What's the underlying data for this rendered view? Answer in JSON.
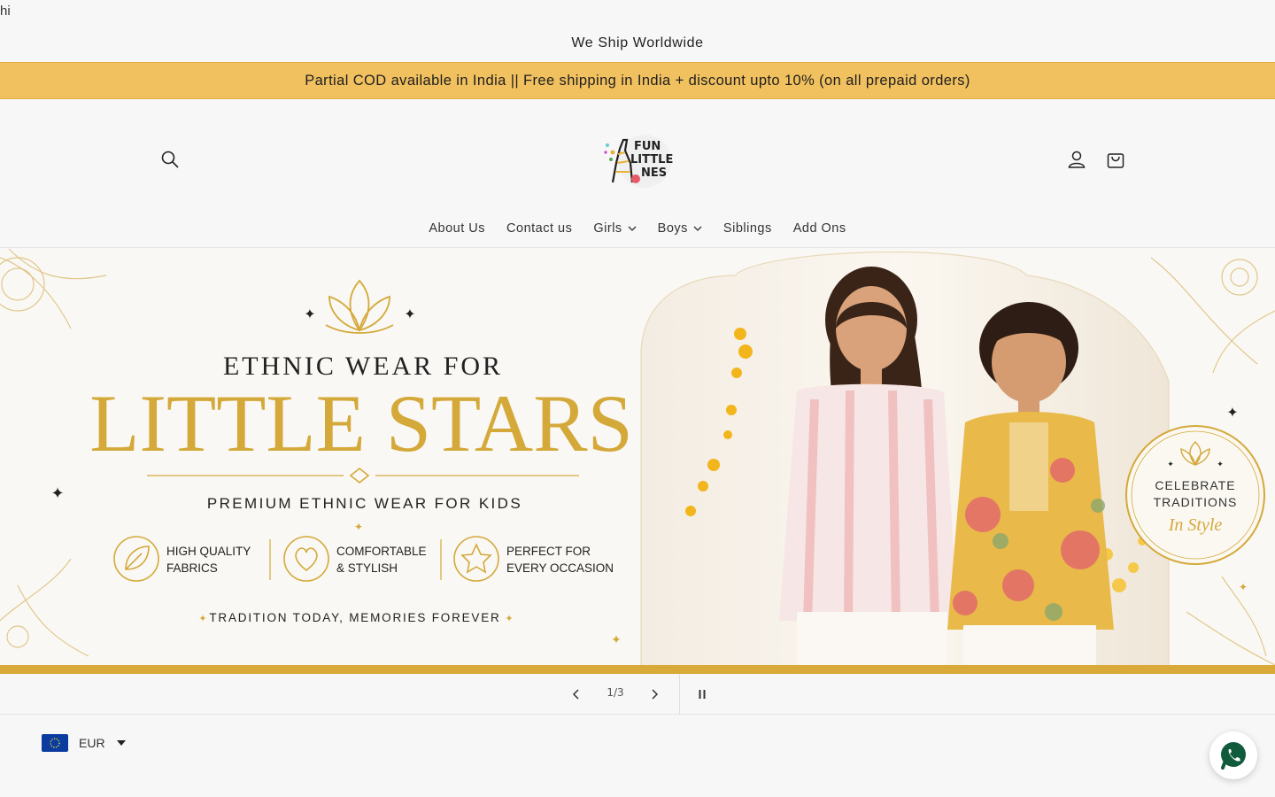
{
  "stray_text": "hi",
  "announcement": {
    "primary": "We Ship Worldwide",
    "secondary": "Partial COD available in India || Free shipping in India + discount upto 10% (on all prepaid orders)",
    "secondary_bg": "#f2c15f"
  },
  "header": {
    "search_icon": "search-icon",
    "account_icon": "account-icon",
    "cart_icon": "cart-icon",
    "logo_lines": [
      "FUN",
      "LITTLE",
      "NES"
    ]
  },
  "nav": {
    "items": [
      {
        "label": "About Us"
      },
      {
        "label": "Contact us"
      },
      {
        "label": "Girls"
      },
      {
        "label": "Boys"
      },
      {
        "label": "Siblings"
      },
      {
        "label": "Add Ons"
      }
    ]
  },
  "banner": {
    "kicker": "ETHNIC WEAR FOR",
    "headline": "LITTLE STARS",
    "subhead": "PREMIUM ETHNIC WEAR FOR KIDS",
    "features": [
      {
        "line1": "HIGH QUALITY",
        "line2": "FABRICS",
        "icon": "leaf-icon"
      },
      {
        "line1": "COMFORTABLE",
        "line2": "& STYLISH",
        "icon": "heart-icon"
      },
      {
        "line1": "PERFECT FOR",
        "line2": "EVERY OCCASION",
        "icon": "star-icon"
      }
    ],
    "tagline": "TRADITION TODAY, MEMORIES FOREVER",
    "badge_line1": "CELEBRATE",
    "badge_line2": "TRADITIONS",
    "badge_script": "In Style",
    "gold": "#d4a93a"
  },
  "slider": {
    "counter": "1/3"
  },
  "currency": {
    "code": "EUR"
  }
}
